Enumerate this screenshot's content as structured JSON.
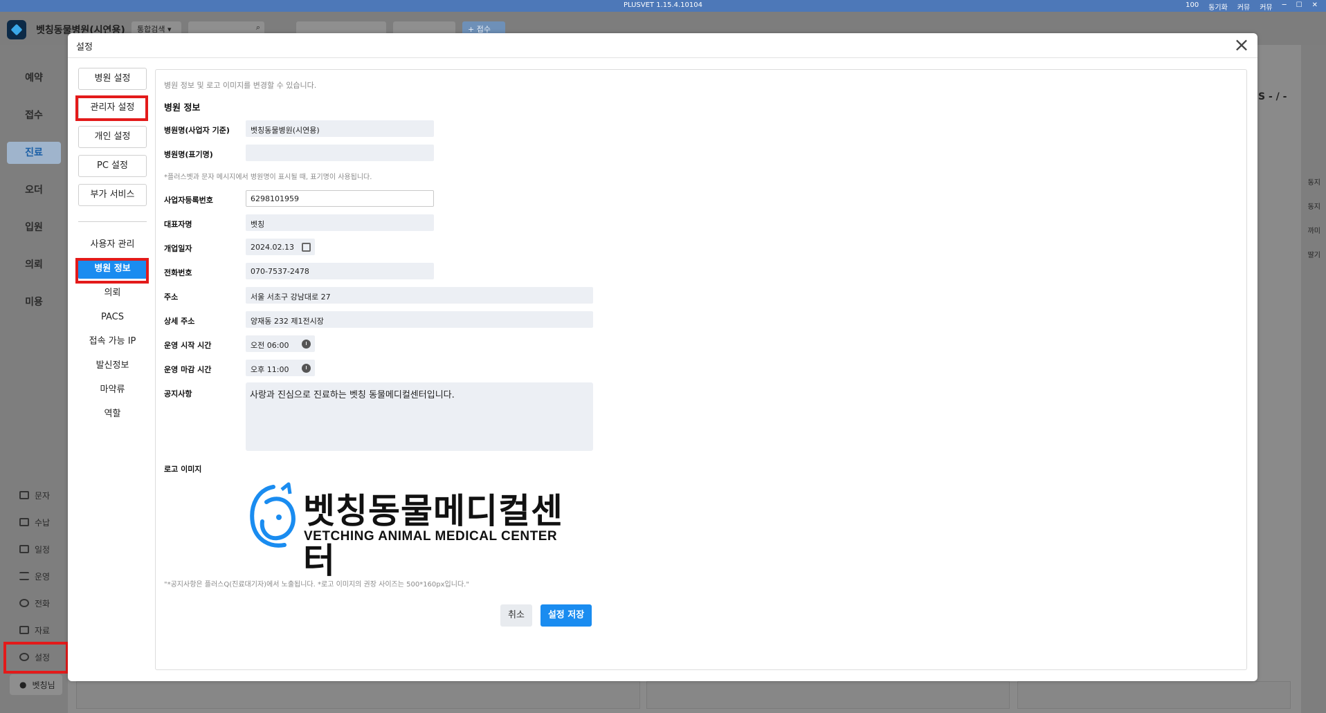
{
  "app": {
    "version": "PLUSVET 1.15.4.10104",
    "hospital_name": "벳칭동물병원(시연용)",
    "search_scope": "통합검색",
    "status_count": "100",
    "sync_label": "동기화",
    "mic_label": "커뮤",
    "phone_label": "커뮤",
    "add_reception_label": "+ 접수"
  },
  "left_nav": {
    "main": [
      "예약",
      "접수",
      "진료",
      "오더",
      "입원",
      "의뢰",
      "미용"
    ],
    "active_main": "진료",
    "sub": [
      {
        "label": "문자",
        "icon": "mail-icon"
      },
      {
        "label": "수납",
        "icon": "card-icon"
      },
      {
        "label": "일정",
        "icon": "calendar-icon"
      },
      {
        "label": "운영",
        "icon": "list-icon"
      },
      {
        "label": "전화",
        "icon": "phone-icon"
      },
      {
        "label": "자료",
        "icon": "doc-icon"
      },
      {
        "label": "설정",
        "icon": "gear-icon"
      }
    ],
    "user": "벳칭님"
  },
  "right_rail": {
    "labels": [
      "동지",
      "동지",
      "까미",
      "딸기"
    ],
    "misc": "S - / -"
  },
  "modal": {
    "title": "설정",
    "side_buttons": [
      "병원 설정",
      "관리자 설정",
      "개인 설정",
      "PC 설정",
      "부가 서비스"
    ],
    "side_links": [
      "사용자 관리",
      "병원 정보",
      "의뢰",
      "PACS",
      "접속 가능 IP",
      "발신정보",
      "마약류",
      "역할"
    ],
    "active_link": "병원 정보",
    "hint": "병원 정보 및 로고 이미지를 변경할 수 있습니다.",
    "section_title": "병원 정보",
    "fields": {
      "name_label": "병원명(사업자 기준)",
      "name_value": "벳칭동물병원(시연용)",
      "display_name_label": "병원명(표기명)",
      "display_name_value": "",
      "display_note": "*플러스벳과 문자 메시지에서 병원명이 표시될 때, 표기명이 사용됩니다.",
      "biz_no_label": "사업자등록번호",
      "biz_no_value": "6298101959",
      "owner_label": "대표자명",
      "owner_value": "벳칭",
      "open_date_label": "개업일자",
      "open_date_value": "2024.02.13",
      "phone_label": "전화번호",
      "phone_value": "070-7537-2478",
      "address_label": "주소",
      "address_value": "서울 서초구 강남대로 27",
      "address_detail_label": "상세 주소",
      "address_detail_value": "양재동 232 제1전시장",
      "start_time_label": "운영 시작 시간",
      "start_time_value": "오전 06:00",
      "end_time_label": "운영 마감 시간",
      "end_time_value": "오후 11:00",
      "notice_label": "공지사항",
      "notice_value": "사랑과 진심으로 진료하는 벳칭 동물메디컬센터입니다.",
      "logo_label": "로고 이미지"
    },
    "logo": {
      "title": "벳칭동물메디컬센터",
      "subtitle": "VETCHING ANIMAL MEDICAL CENTER",
      "color": "#1a8cf0"
    },
    "footer_note": "\"*공지사항은 플러스Q(진료대기자)에서 노출됩니다. *로고 이미지의 권장 사이즈는 500*160px입니다.\"",
    "cancel_label": "취소",
    "save_label": "설정 저장"
  },
  "colors": {
    "accent": "#1a8cf0",
    "highlight": "#e31a1a",
    "titlebar": "#4d78b8"
  }
}
